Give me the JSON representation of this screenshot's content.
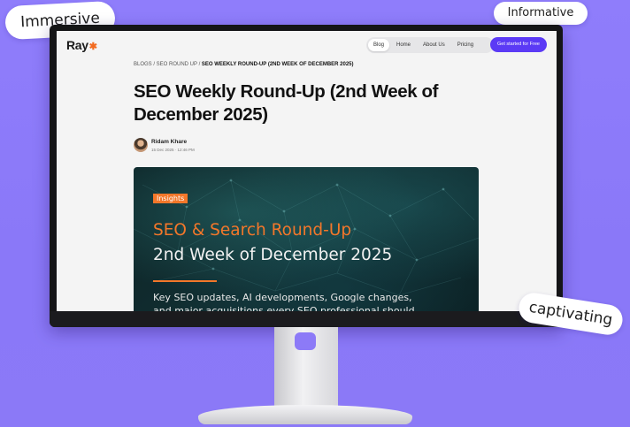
{
  "stickers": {
    "immersive": "Immersive",
    "informative": "Informative",
    "captivating": "captivating"
  },
  "site": {
    "logo": "Ray",
    "logo_mark": "✱",
    "nav": [
      "Blog",
      "Home",
      "About Us",
      "Pricing"
    ],
    "nav_active": "Blog",
    "cta": "Get started for Free"
  },
  "article": {
    "breadcrumb_prefix": "BLOGS / SEO ROUND UP / ",
    "breadcrumb_current": "SEO WEEKLY ROUND-UP (2ND WEEK OF DECEMBER 2025)",
    "title": "SEO Weekly Round-Up (2nd Week of December 2025)",
    "author": "Ridam Khare",
    "date": "15 Dec 2025 · 12:46 PM"
  },
  "hero": {
    "tag": "Insights",
    "line1": "SEO & Search Round-Up",
    "line2": "2nd Week of December 2025",
    "description": "Key SEO updates, AI developments, Google changes, and major acquisitions every SEO professional should track this week."
  },
  "colors": {
    "background": "#8f7dfb",
    "accent_orange": "#f3772a",
    "cta_purple": "#5b3af5"
  }
}
